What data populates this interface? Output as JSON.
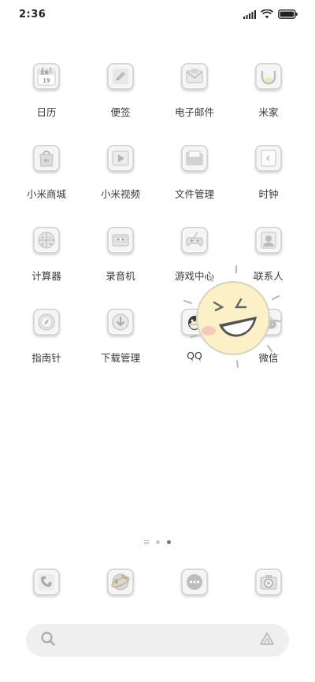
{
  "status_bar": {
    "time": "2:36",
    "icons": [
      "signal-icon",
      "wifi-icon",
      "battery-icon"
    ]
  },
  "apps": [
    {
      "label": "日历",
      "icon": "calendar-icon",
      "icon_text_top": "星期一",
      "icon_text_bottom": "19"
    },
    {
      "label": "便签",
      "icon": "notes-icon"
    },
    {
      "label": "电子邮件",
      "icon": "email-icon"
    },
    {
      "label": "米家",
      "icon": "mijia-icon"
    },
    {
      "label": "小米商城",
      "icon": "mi-store-icon",
      "icon_text": "MI"
    },
    {
      "label": "小米视频",
      "icon": "video-icon"
    },
    {
      "label": "文件管理",
      "icon": "file-manager-icon"
    },
    {
      "label": "时钟",
      "icon": "clock-icon"
    },
    {
      "label": "计算器",
      "icon": "calculator-icon"
    },
    {
      "label": "录音机",
      "icon": "recorder-icon"
    },
    {
      "label": "游戏中心",
      "icon": "game-center-icon"
    },
    {
      "label": "联系人",
      "icon": "contacts-icon"
    },
    {
      "label": "指南针",
      "icon": "compass-icon"
    },
    {
      "label": "下载管理",
      "icon": "download-icon"
    },
    {
      "label": "QQ",
      "icon": "qq-icon"
    },
    {
      "label": "微信",
      "icon": "wechat-icon"
    }
  ],
  "page_indicator": {
    "pages": 3,
    "active": 2
  },
  "dock": [
    {
      "icon": "phone-icon"
    },
    {
      "icon": "browser-icon"
    },
    {
      "icon": "messages-icon"
    },
    {
      "icon": "camera-icon"
    }
  ],
  "search_bar": {
    "left_icon": "search-icon",
    "right_icon": "assistant-icon"
  },
  "colors": {
    "icon_border": "#d6d6d6",
    "icon_bg": "#f5f5f5",
    "sun_face": "#fbf0c6",
    "sun_cheek": "#f6c9b8"
  }
}
